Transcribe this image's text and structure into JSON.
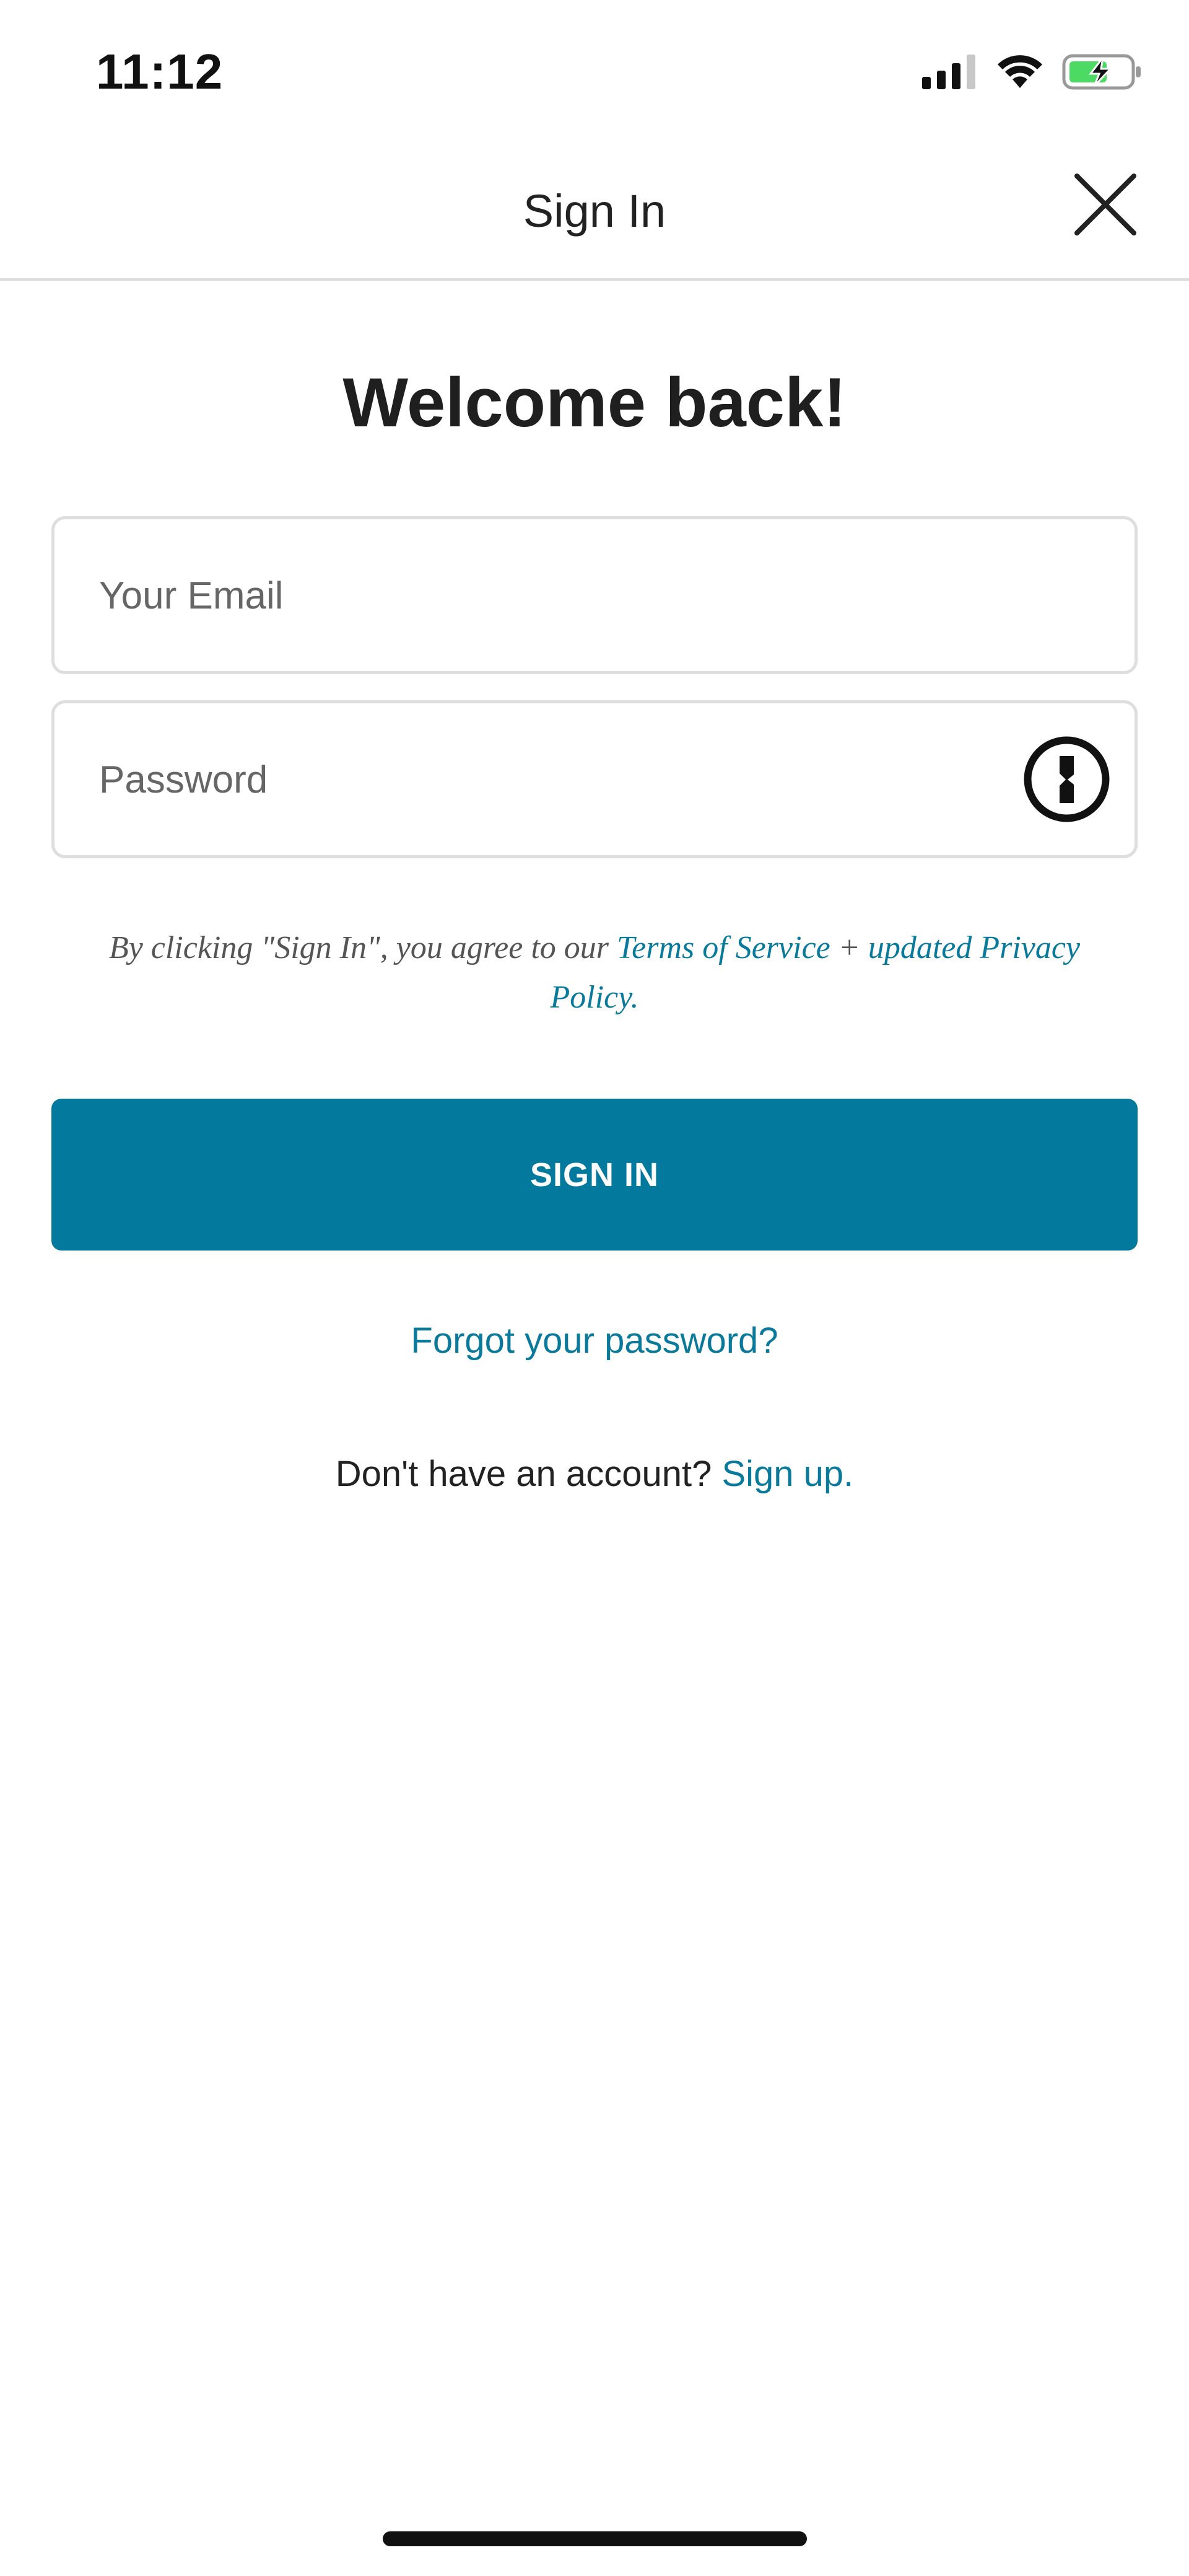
{
  "status_bar": {
    "time": "11:12",
    "icons": [
      "signal-icon",
      "wifi-icon",
      "battery-charging-icon"
    ],
    "battery_color": "#4cd964"
  },
  "nav": {
    "title": "Sign In",
    "close_icon": "close-icon"
  },
  "main": {
    "heading": "Welcome back!",
    "email": {
      "placeholder": "Your Email",
      "value": ""
    },
    "password": {
      "placeholder": "Password",
      "value": "",
      "manager_icon": "password-manager-icon"
    },
    "terms": {
      "prefix": "By clicking \"Sign In\", you agree to our ",
      "tos_link": "Terms of Service",
      "joiner": " + ",
      "privacy_link": "updated Privacy Policy",
      "suffix": "."
    },
    "signin_button": "SIGN IN",
    "forgot_link": "Forgot your password?",
    "signup_prompt": "Don't have an account? ",
    "signup_link": "Sign up."
  },
  "colors": {
    "accent": "#02799d",
    "link": "#0a7a9c"
  }
}
